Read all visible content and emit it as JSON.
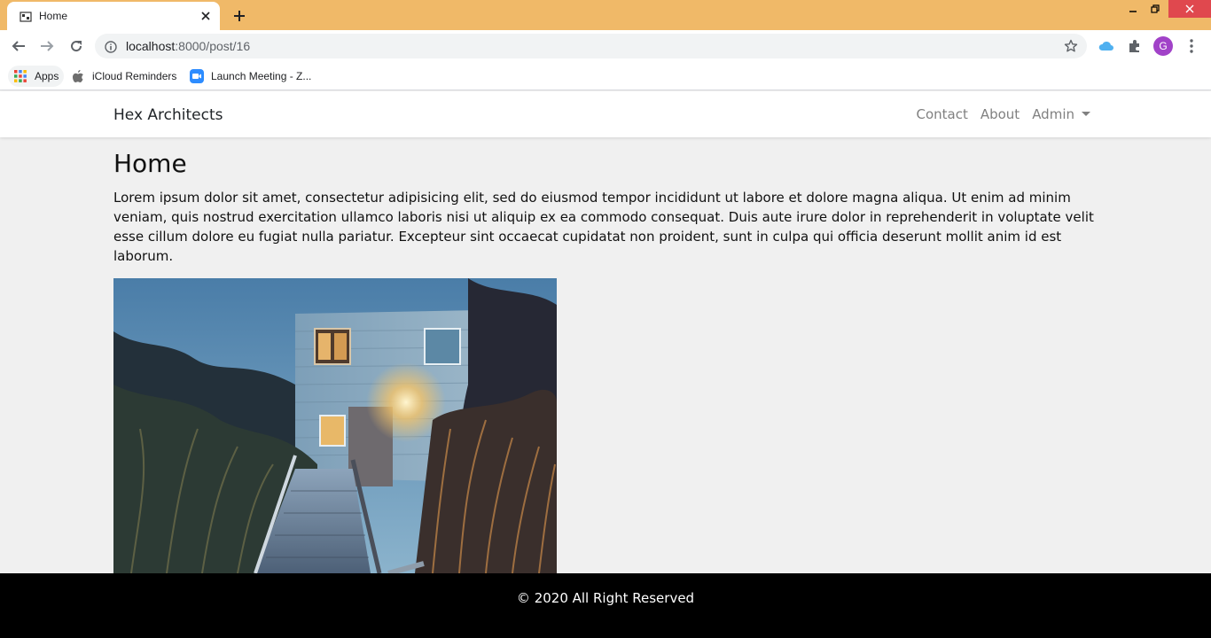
{
  "browser": {
    "tab_title": "Home",
    "url_host": "localhost",
    "url_path": ":8000/post/16",
    "profile_initial": "G",
    "bookmarks": [
      {
        "label": "Apps",
        "icon": "apps-grid-icon"
      },
      {
        "label": "iCloud Reminders",
        "icon": "apple-icon"
      },
      {
        "label": "Launch Meeting - Z...",
        "icon": "zoom-icon"
      }
    ],
    "colors": {
      "tabstrip": "#f0b968",
      "close": "#e0484e",
      "profile": "#a142c8"
    }
  },
  "navbar": {
    "brand": "Hex Architects",
    "links": [
      "Contact",
      "About",
      "Admin"
    ]
  },
  "main": {
    "heading": "Home",
    "body": "Lorem ipsum dolor sit amet, consectetur adipisicing elit, sed do eiusmod tempor incididunt ut labore et dolore magna aliqua. Ut enim ad minim veniam, quis nostrud exercitation ullamco laboris nisi ut aliquip ex ea commodo consequat. Duis aute irure dolor in reprehenderit in voluptate velit esse cillum dolore eu fugiat nulla pariatur. Excepteur sint occaecat cupidatat non proident, sunt in culpa qui officia deserunt mollit anim id est laborum.",
    "image": "house-photo"
  },
  "footer": {
    "copyright": "© 2020 All Right Reserved"
  }
}
